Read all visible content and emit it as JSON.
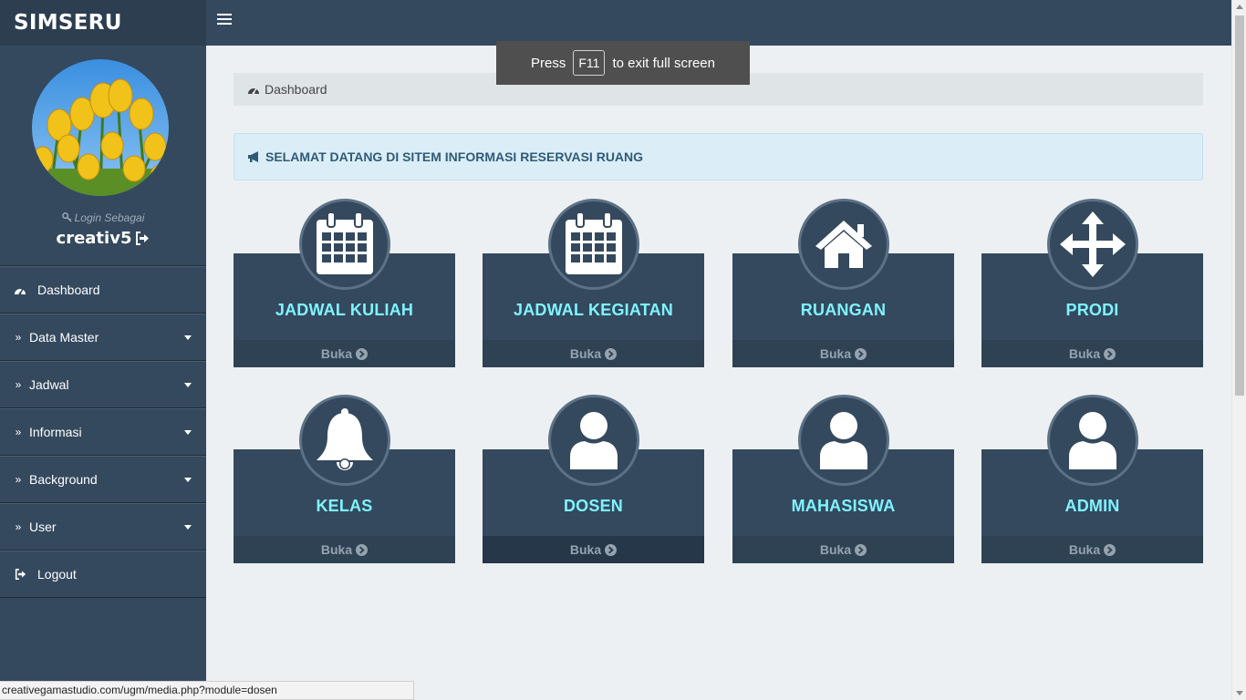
{
  "app": {
    "brand": "SIMSERU"
  },
  "toast": {
    "before": "Press",
    "key": "F11",
    "after": "to exit full screen"
  },
  "sidebar": {
    "login_label": "Login Sebagai",
    "username": "creativ5",
    "items": [
      {
        "label": "Dashboard",
        "icon": "dashboard-icon",
        "dropdown": false
      },
      {
        "label": "Data Master",
        "icon": "double-chevron-right-icon",
        "dropdown": true
      },
      {
        "label": "Jadwal",
        "icon": "double-chevron-right-icon",
        "dropdown": true
      },
      {
        "label": "Informasi",
        "icon": "double-chevron-right-icon",
        "dropdown": true
      },
      {
        "label": "Background",
        "icon": "double-chevron-right-icon",
        "dropdown": true
      },
      {
        "label": "User",
        "icon": "double-chevron-right-icon",
        "dropdown": true
      },
      {
        "label": "Logout",
        "icon": "logout-icon",
        "dropdown": false
      }
    ]
  },
  "breadcrumb": {
    "label": "Dashboard"
  },
  "alert": {
    "text": "SELAMAT DATANG DI SITEM INFORMASI RESERVASI RUANG"
  },
  "tiles": [
    {
      "title": "JADWAL KULIAH",
      "icon": "calendar-icon",
      "footer": "Buka"
    },
    {
      "title": "JADWAL KEGIATAN",
      "icon": "calendar-icon",
      "footer": "Buka"
    },
    {
      "title": "RUANGAN",
      "icon": "home-icon",
      "footer": "Buka"
    },
    {
      "title": "PRODI",
      "icon": "move-arrows-icon",
      "footer": "Buka"
    },
    {
      "title": "KELAS",
      "icon": "bell-icon",
      "footer": "Buka"
    },
    {
      "title": "DOSEN",
      "icon": "user-icon",
      "footer": "Buka"
    },
    {
      "title": "MAHASISWA",
      "icon": "user-icon",
      "footer": "Buka"
    },
    {
      "title": "ADMIN",
      "icon": "user-icon",
      "footer": "Buka"
    }
  ],
  "status_url": "creativegamastudio.com/ugm/media.php?module=dosen",
  "colors": {
    "sidebar": "#34495e",
    "brand_bg": "#2c3e50",
    "tile_title": "#7ff3ff",
    "content_bg": "#edf0f2"
  }
}
